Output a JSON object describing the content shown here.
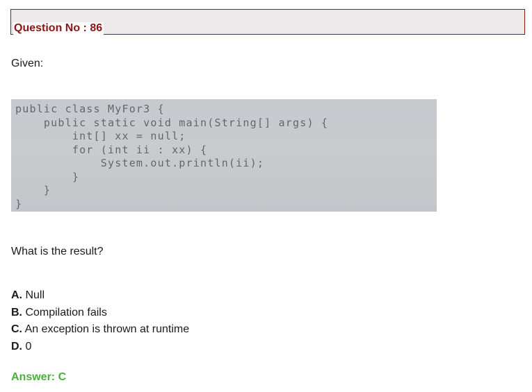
{
  "question": {
    "title": "Question No : 86",
    "given_label": "Given:",
    "code": "public class MyFor3 {\n    public static void main(String[] args) {\n        int[] xx = null;\n        for (int ii : xx) {\n            System.out.println(ii);\n        }\n    }\n}",
    "prompt": "What is the result?",
    "options": [
      {
        "letter": "A.",
        "text": " Null"
      },
      {
        "letter": "B.",
        "text": " Compilation fails"
      },
      {
        "letter": "C.",
        "text": " An exception is thrown at runtime"
      },
      {
        "letter": "D.",
        "text": " 0"
      }
    ],
    "answer": "Answer: C"
  },
  "colors": {
    "header_text": "#8b1414",
    "header_border": "#8b1a1a",
    "header_background": "#ece9ea",
    "answer": "#4caf3d"
  }
}
